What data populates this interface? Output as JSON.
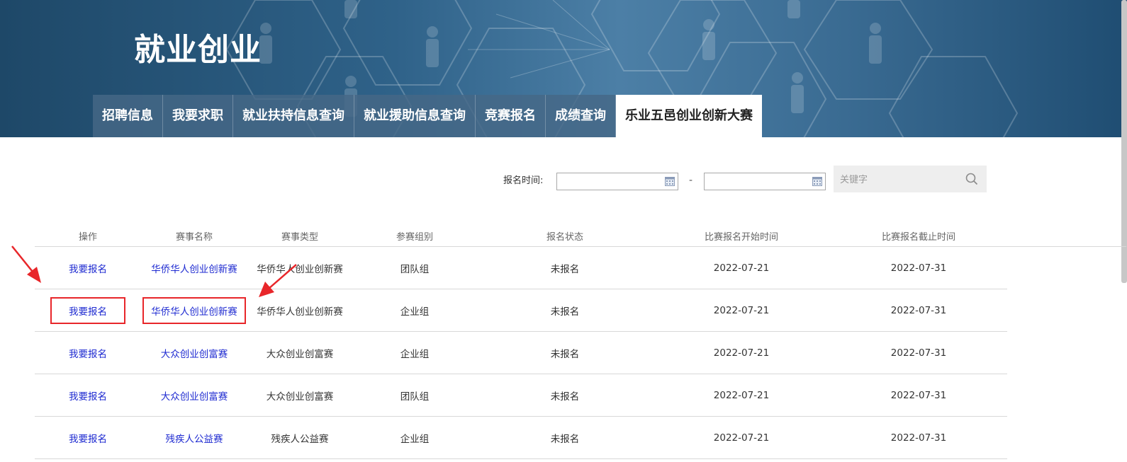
{
  "site": {
    "title": "就业创业"
  },
  "nav": {
    "tabs": [
      {
        "label": "招聘信息",
        "active": false
      },
      {
        "label": "我要求职",
        "active": false
      },
      {
        "label": "就业扶持信息查询",
        "active": false
      },
      {
        "label": "就业援助信息查询",
        "active": false
      },
      {
        "label": "竞赛报名",
        "active": false
      },
      {
        "label": "成绩查询",
        "active": false
      },
      {
        "label": "乐业五邑创业创新大赛",
        "active": true
      }
    ]
  },
  "filter": {
    "date_label": "报名时间:",
    "date_start": "",
    "date_end": "",
    "separator": "-",
    "keyword_placeholder": "关键字"
  },
  "table": {
    "headers": [
      "操作",
      "赛事名称",
      "赛事类型",
      "参赛组别",
      "报名状态",
      "比赛报名开始时间",
      "比赛报名截止时间"
    ],
    "rows": [
      {
        "action": "我要报名",
        "name": "华侨华人创业创新赛",
        "type": "华侨华人创业创新赛",
        "group": "团队组",
        "status": "未报名",
        "start": "2022-07-21",
        "end": "2022-07-31"
      },
      {
        "action": "我要报名",
        "name": "华侨华人创业创新赛",
        "type": "华侨华人创业创新赛",
        "group": "企业组",
        "status": "未报名",
        "start": "2022-07-21",
        "end": "2022-07-31"
      },
      {
        "action": "我要报名",
        "name": "大众创业创富赛",
        "type": "大众创业创富赛",
        "group": "企业组",
        "status": "未报名",
        "start": "2022-07-21",
        "end": "2022-07-31"
      },
      {
        "action": "我要报名",
        "name": "大众创业创富赛",
        "type": "大众创业创富赛",
        "group": "团队组",
        "status": "未报名",
        "start": "2022-07-21",
        "end": "2022-07-31"
      },
      {
        "action": "我要报名",
        "name": "残疾人公益赛",
        "type": "残疾人公益赛",
        "group": "企业组",
        "status": "未报名",
        "start": "2022-07-21",
        "end": "2022-07-31"
      }
    ]
  },
  "annotations": {
    "highlight_color": "#e8262a"
  },
  "colors": {
    "banner": "#2f6289",
    "link": "#1f2bd1",
    "tab": "#466886"
  }
}
